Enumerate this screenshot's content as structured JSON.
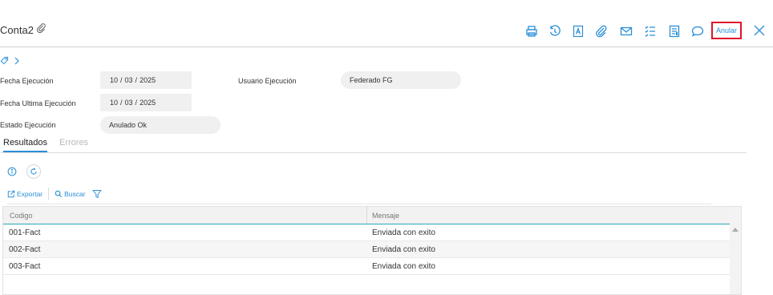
{
  "header": {
    "title": "Conta2",
    "toolbar": [
      "print-icon",
      "history-icon",
      "text-document-icon",
      "attach-icon",
      "mail-icon",
      "checklist-icon",
      "report-icon",
      "comment-icon"
    ],
    "anular_label": "Anular"
  },
  "fields": {
    "fecha_ejecucion": {
      "label": "Fecha Ejecución",
      "day": "10",
      "month": "03",
      "year": "2025"
    },
    "fecha_ultima": {
      "label": "Fecha Ultima Ejecución",
      "day": "10",
      "month": "03",
      "year": "2025"
    },
    "estado": {
      "label": "Estado Ejecución",
      "value": "Anulado Ok"
    },
    "usuario": {
      "label": "Usuario Ejecución",
      "value": "Federado FG"
    }
  },
  "tabs": [
    {
      "label": "Resultados",
      "active": true
    },
    {
      "label": "Errores",
      "active": false
    }
  ],
  "grid_toolbar": {
    "export_label": "Exportar",
    "search_label": "Buscar"
  },
  "grid": {
    "columns": [
      "Codigo",
      "Mensaje"
    ],
    "rows": [
      [
        "001-Fact",
        "Enviada con exito"
      ],
      [
        "002-Fact",
        "Enviada con exito"
      ],
      [
        "003-Fact",
        "Enviada con exito"
      ]
    ]
  },
  "colors": {
    "accent": "#2a8fd6",
    "highlight": "#e0142b",
    "header_line": "#29a6b7"
  }
}
